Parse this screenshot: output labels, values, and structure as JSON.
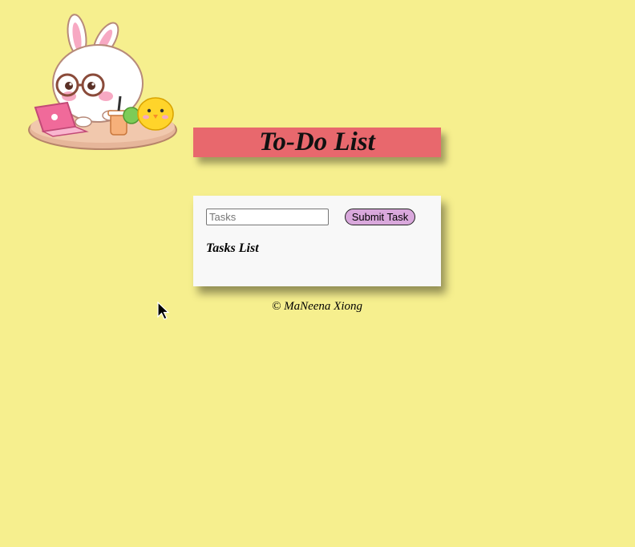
{
  "title": "To-Do List",
  "form": {
    "input_placeholder": "Tasks",
    "input_value": "",
    "submit_label": "Submit Task"
  },
  "tasks_heading": "Tasks List",
  "tasks": [],
  "footer": "© MaNeena Xiong",
  "colors": {
    "background": "#f6ef8e",
    "banner": "#e8686d",
    "card": "#f8f8f8",
    "button": "#d9a8dc"
  },
  "icons": {
    "mascot": "bunny-with-laptop-illustration",
    "cursor": "mouse-pointer-icon"
  }
}
